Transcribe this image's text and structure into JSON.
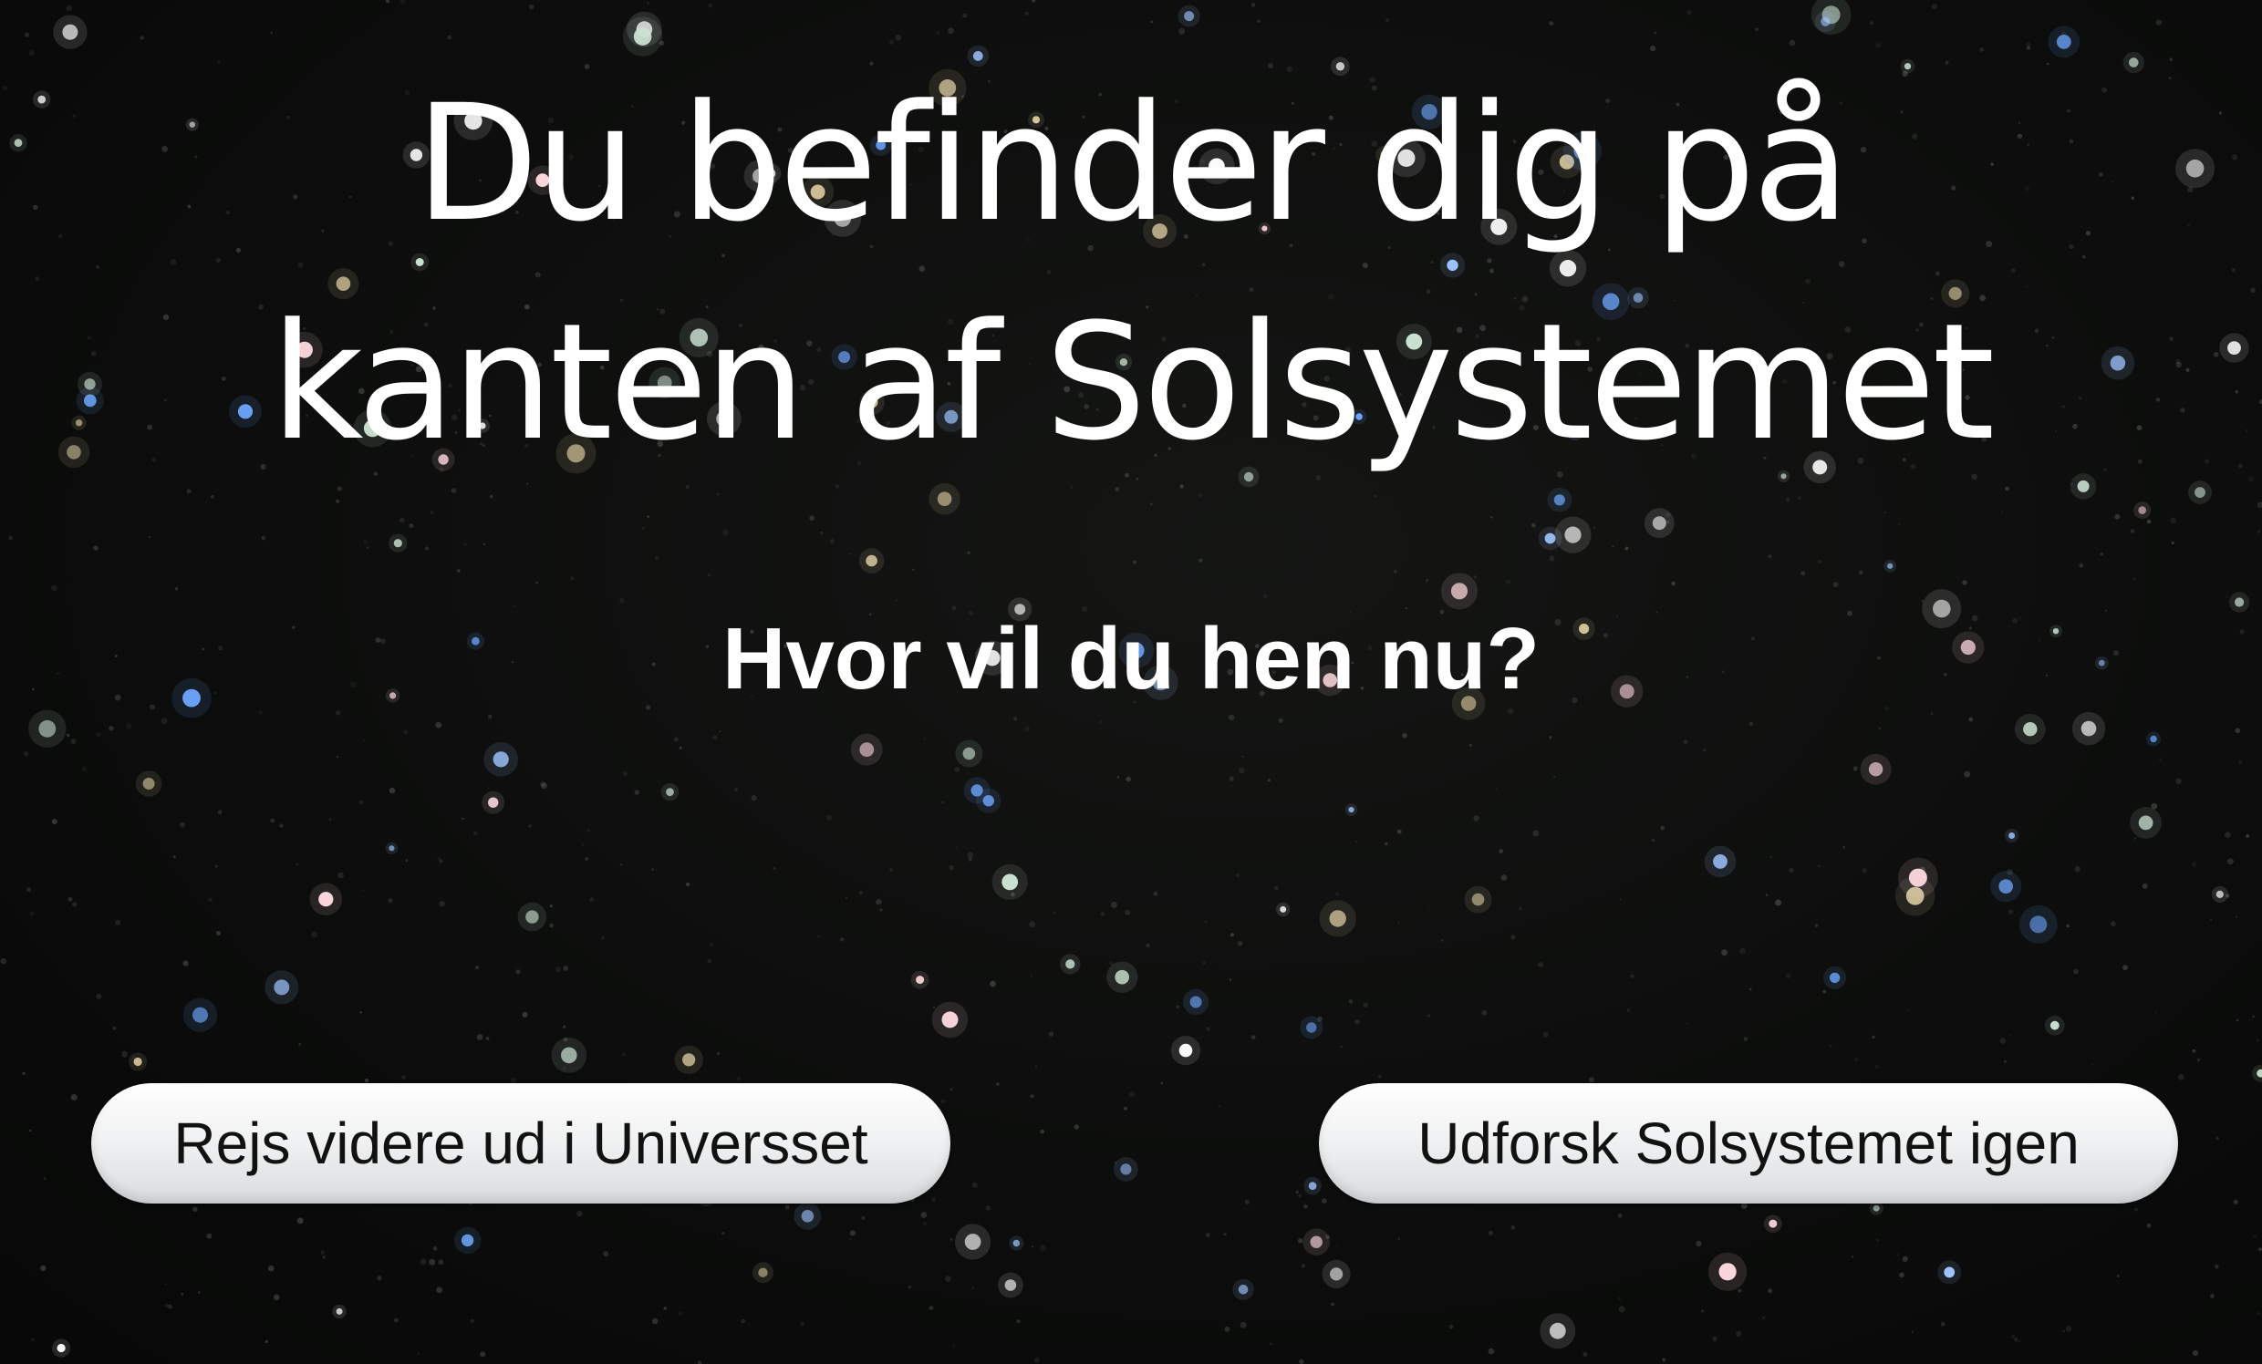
{
  "page": {
    "heading_line1": "Du befinder dig på",
    "heading_line2": "kanten af Solsystemet",
    "question": "Hvor vil du hen nu?"
  },
  "buttons": {
    "travel_on": "Rejs videre ud i Universset",
    "explore_again": "Udforsk Solsystemet igen"
  },
  "theme": {
    "background": "#0b0c0b",
    "text": "#ffffff",
    "button_text": "#111111",
    "star_colors": [
      "#ffffff",
      "#6fa8ff",
      "#9ec4ff",
      "#d9c9a0",
      "#c9e0d0",
      "#ffd9e0"
    ]
  }
}
